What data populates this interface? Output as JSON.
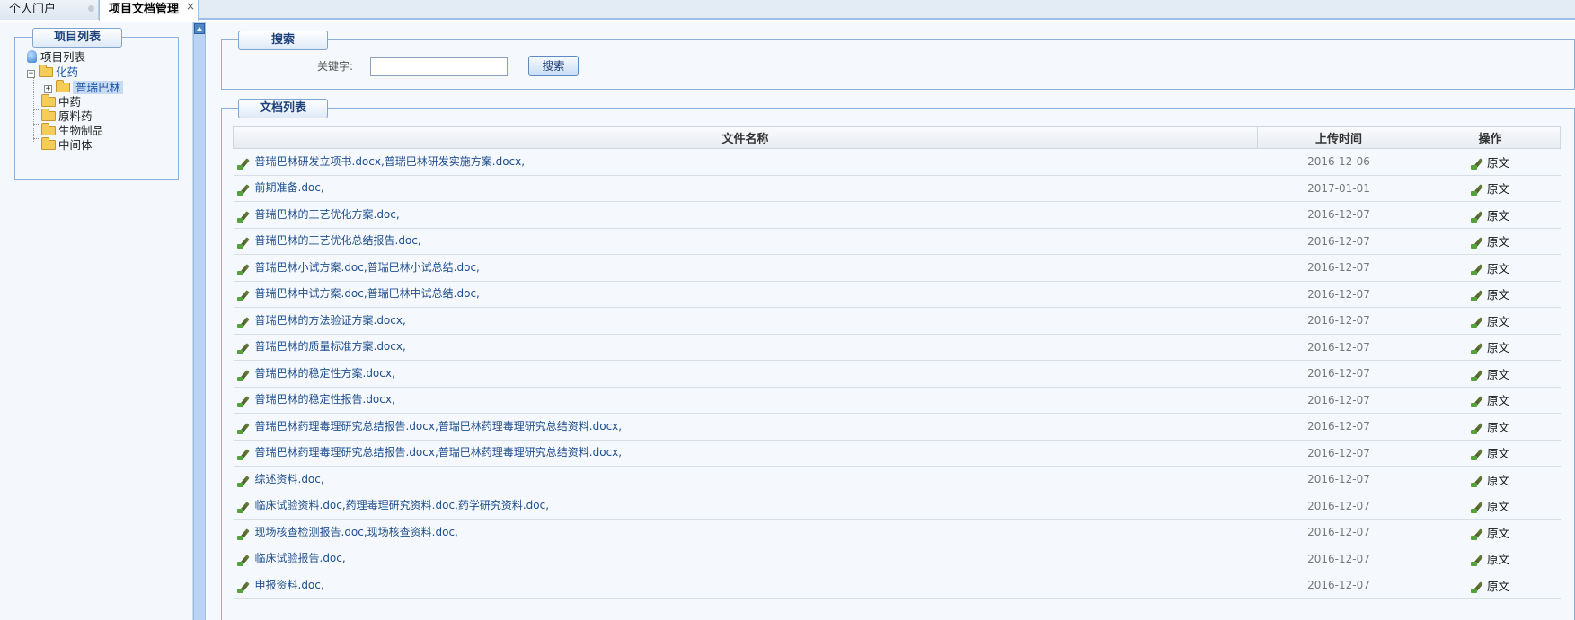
{
  "tabs": [
    {
      "label": "个人门户",
      "active": false
    },
    {
      "label": "项目文档管理",
      "active": true,
      "close": "×"
    }
  ],
  "left": {
    "legend": "项目列表",
    "tree": {
      "root": "项目列表",
      "nodes": [
        {
          "label": "化药",
          "expanded": true,
          "toggle": "−"
        },
        {
          "label": "普瑞巴林",
          "selected": true,
          "toggle": "+"
        },
        {
          "label": "中药"
        },
        {
          "label": "原料药"
        },
        {
          "label": "生物制品"
        },
        {
          "label": "中间体"
        }
      ]
    }
  },
  "search": {
    "legend": "搜索",
    "keyword_label": "关键字:",
    "keyword_value": "",
    "button": "搜索"
  },
  "docs": {
    "legend": "文档列表",
    "columns": [
      "文件名称",
      "上传时间",
      "操作"
    ],
    "action_label": "原文",
    "rows": [
      {
        "name": "普瑞巴林研发立项书.docx,普瑞巴林研发实施方案.docx,",
        "date": "2016-12-06"
      },
      {
        "name": "前期准备.doc,",
        "date": "2017-01-01"
      },
      {
        "name": "普瑞巴林的工艺优化方案.doc,",
        "date": "2016-12-07"
      },
      {
        "name": "普瑞巴林的工艺优化总结报告.doc,",
        "date": "2016-12-07"
      },
      {
        "name": "普瑞巴林小试方案.doc,普瑞巴林小试总结.doc,",
        "date": "2016-12-07"
      },
      {
        "name": "普瑞巴林中试方案.doc,普瑞巴林中试总结.doc,",
        "date": "2016-12-07"
      },
      {
        "name": "普瑞巴林的方法验证方案.docx,",
        "date": "2016-12-07"
      },
      {
        "name": "普瑞巴林的质量标准方案.docx,",
        "date": "2016-12-07"
      },
      {
        "name": "普瑞巴林的稳定性方案.docx,",
        "date": "2016-12-07"
      },
      {
        "name": "普瑞巴林的稳定性报告.docx,",
        "date": "2016-12-07"
      },
      {
        "name": "普瑞巴林药理毒理研究总结报告.docx,普瑞巴林药理毒理研究总结资料.docx,",
        "date": "2016-12-07"
      },
      {
        "name": "普瑞巴林药理毒理研究总结报告.docx,普瑞巴林药理毒理研究总结资料.docx,",
        "date": "2016-12-07"
      },
      {
        "name": "综述资料.doc,",
        "date": "2016-12-07"
      },
      {
        "name": "临床试验资料.doc,药理毒理研究资料.doc,药学研究资料.doc,",
        "date": "2016-12-07"
      },
      {
        "name": "现场核查检测报告.doc,现场核查资料.doc,",
        "date": "2016-12-07"
      },
      {
        "name": "临床试验报告.doc,",
        "date": "2016-12-07"
      },
      {
        "name": "申报资料.doc,",
        "date": "2016-12-07"
      }
    ]
  }
}
